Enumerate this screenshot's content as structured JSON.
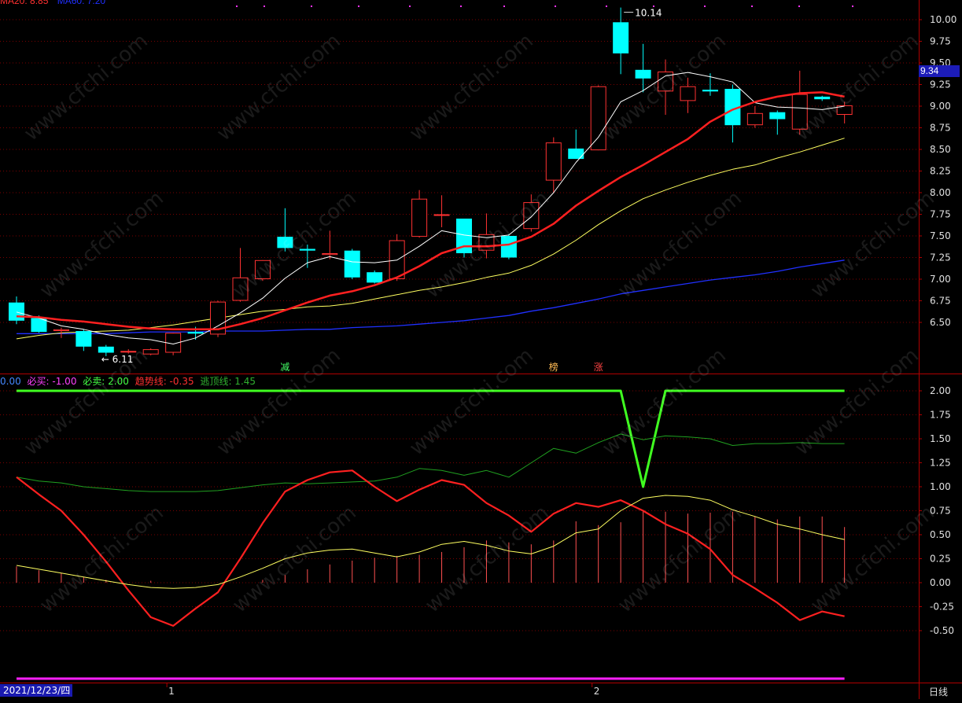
{
  "colors": {
    "up": "#ff3232",
    "down": "#00ffff",
    "ma_white": "#ffffff",
    "ma_red": "#ff2020",
    "ma_yellow": "#ffff60",
    "ma_blue": "#2030ff",
    "grid": "#7a0000",
    "axis_text": "#e0e0e0"
  },
  "top_legend": {
    "ma_text": "MA20: 8.85",
    "extra_text": "MA60: 7.20"
  },
  "price_tag": "9.34",
  "date_label": "2021/12/23/四",
  "period_label": "日线",
  "chart_data": [
    {
      "type": "candlestick",
      "ylim": [
        6.0,
        10.25
      ],
      "y_ticks": [
        "10.00",
        "9.75",
        "9.50",
        "9.25",
        "9.00",
        "8.75",
        "8.50",
        "8.25",
        "8.00",
        "7.75",
        "7.50",
        "7.25",
        "7.00",
        "6.75",
        "6.50"
      ],
      "x_ticks": [
        "1",
        "2"
      ],
      "annotations": {
        "high_label": "10.14",
        "low_label": "6.11"
      },
      "signals": [
        {
          "text": "减",
          "index": 12,
          "color": "#44ff66"
        },
        {
          "text": "榜",
          "index": 24,
          "color": "#ffbb55"
        },
        {
          "text": "涨",
          "index": 26,
          "color": "#ff4444"
        }
      ],
      "candles": [
        {
          "o": 6.73,
          "h": 6.8,
          "l": 6.48,
          "c": 6.52
        },
        {
          "o": 6.55,
          "h": 6.58,
          "l": 6.38,
          "c": 6.39
        },
        {
          "o": 6.4,
          "h": 6.44,
          "l": 6.32,
          "c": 6.42
        },
        {
          "o": 6.4,
          "h": 6.42,
          "l": 6.17,
          "c": 6.22
        },
        {
          "o": 6.22,
          "h": 6.24,
          "l": 6.11,
          "c": 6.15
        },
        {
          "o": 6.16,
          "h": 6.19,
          "l": 6.14,
          "c": 6.17
        },
        {
          "o": 6.13,
          "h": 6.2,
          "l": 6.12,
          "c": 6.19
        },
        {
          "o": 6.15,
          "h": 6.38,
          "l": 6.12,
          "c": 6.38
        },
        {
          "o": 6.39,
          "h": 6.45,
          "l": 6.3,
          "c": 6.37
        },
        {
          "o": 6.36,
          "h": 6.75,
          "l": 6.33,
          "c": 6.74
        },
        {
          "o": 6.75,
          "h": 7.36,
          "l": 6.74,
          "c": 7.02
        },
        {
          "o": 7.0,
          "h": 7.22,
          "l": 6.98,
          "c": 7.22
        },
        {
          "o": 7.49,
          "h": 7.82,
          "l": 7.32,
          "c": 7.36
        },
        {
          "o": 7.35,
          "h": 7.4,
          "l": 7.13,
          "c": 7.33
        },
        {
          "o": 7.28,
          "h": 7.56,
          "l": 7.23,
          "c": 7.3
        },
        {
          "o": 7.33,
          "h": 7.35,
          "l": 7.0,
          "c": 7.02
        },
        {
          "o": 7.08,
          "h": 7.1,
          "l": 6.95,
          "c": 6.96
        },
        {
          "o": 7.0,
          "h": 7.52,
          "l": 6.98,
          "c": 7.45
        },
        {
          "o": 7.49,
          "h": 8.03,
          "l": 7.48,
          "c": 7.93
        },
        {
          "o": 7.75,
          "h": 7.97,
          "l": 7.6,
          "c": 7.75
        },
        {
          "o": 7.7,
          "h": 7.7,
          "l": 7.25,
          "c": 7.3
        },
        {
          "o": 7.33,
          "h": 7.76,
          "l": 7.24,
          "c": 7.52
        },
        {
          "o": 7.5,
          "h": 7.52,
          "l": 7.23,
          "c": 7.25
        },
        {
          "o": 7.58,
          "h": 7.98,
          "l": 7.55,
          "c": 7.89
        },
        {
          "o": 8.14,
          "h": 8.64,
          "l": 8.0,
          "c": 8.58
        },
        {
          "o": 8.51,
          "h": 8.73,
          "l": 8.39,
          "c": 8.39
        },
        {
          "o": 8.49,
          "h": 9.24,
          "l": 8.49,
          "c": 9.23
        },
        {
          "o": 9.97,
          "h": 10.14,
          "l": 9.37,
          "c": 9.61
        },
        {
          "o": 9.42,
          "h": 9.72,
          "l": 9.16,
          "c": 9.32
        },
        {
          "o": 9.17,
          "h": 9.54,
          "l": 8.9,
          "c": 9.4
        },
        {
          "o": 9.06,
          "h": 9.33,
          "l": 8.92,
          "c": 9.23
        },
        {
          "o": 9.19,
          "h": 9.38,
          "l": 9.12,
          "c": 9.17
        },
        {
          "o": 9.2,
          "h": 9.25,
          "l": 8.58,
          "c": 8.78
        },
        {
          "o": 8.78,
          "h": 9.0,
          "l": 8.75,
          "c": 8.92
        },
        {
          "o": 8.93,
          "h": 8.95,
          "l": 8.67,
          "c": 8.85
        },
        {
          "o": 8.73,
          "h": 9.41,
          "l": 8.67,
          "c": 9.14
        },
        {
          "o": 9.11,
          "h": 9.12,
          "l": 9.06,
          "c": 9.08
        },
        {
          "o": 8.9,
          "h": 9.05,
          "l": 8.8,
          "c": 9.01
        }
      ],
      "ma_white": [
        6.62,
        6.55,
        6.46,
        6.42,
        6.36,
        6.32,
        6.3,
        6.25,
        6.32,
        6.46,
        6.61,
        6.78,
        7.01,
        7.19,
        7.26,
        7.2,
        7.19,
        7.22,
        7.38,
        7.56,
        7.51,
        7.48,
        7.51,
        7.72,
        8.0,
        8.35,
        8.64,
        9.05,
        9.18,
        9.35,
        9.39,
        9.34,
        9.28,
        9.04,
        8.99,
        8.98,
        8.96,
        9.0
      ],
      "ma_red": [
        6.57,
        6.56,
        6.53,
        6.51,
        6.48,
        6.45,
        6.43,
        6.42,
        6.42,
        6.42,
        6.48,
        6.55,
        6.64,
        6.73,
        6.81,
        6.86,
        6.93,
        7.02,
        7.15,
        7.3,
        7.38,
        7.38,
        7.4,
        7.49,
        7.64,
        7.85,
        8.02,
        8.18,
        8.32,
        8.47,
        8.62,
        8.82,
        8.96,
        9.05,
        9.11,
        9.15,
        9.16,
        9.11
      ],
      "ma_yellow": [
        6.31,
        6.35,
        6.38,
        6.39,
        6.4,
        6.41,
        6.44,
        6.47,
        6.51,
        6.55,
        6.59,
        6.63,
        6.65,
        6.68,
        6.69,
        6.72,
        6.77,
        6.82,
        6.87,
        6.91,
        6.96,
        7.02,
        7.07,
        7.16,
        7.29,
        7.45,
        7.63,
        7.79,
        7.93,
        8.03,
        8.12,
        8.2,
        8.27,
        8.32,
        8.4,
        8.47,
        8.55,
        8.63
      ],
      "ma_blue": [
        6.37,
        6.37,
        6.37,
        6.37,
        6.37,
        6.38,
        6.39,
        6.39,
        6.39,
        6.4,
        6.4,
        6.4,
        6.41,
        6.42,
        6.42,
        6.44,
        6.45,
        6.46,
        6.48,
        6.5,
        6.52,
        6.55,
        6.58,
        6.63,
        6.67,
        6.72,
        6.77,
        6.83,
        6.87,
        6.91,
        6.95,
        6.99,
        7.02,
        7.05,
        7.09,
        7.14,
        7.18,
        7.22
      ]
    },
    {
      "type": "line",
      "ylim": [
        -0.8,
        2.25
      ],
      "y_ticks": [
        "2.00",
        "1.75",
        "1.50",
        "1.25",
        "1.00",
        "0.75",
        "0.50",
        "0.25",
        "0.00",
        "-0.25",
        "-0.50"
      ],
      "legend": [
        {
          "text": "0.00",
          "color": "#4488ff"
        },
        {
          "text": "必买: -1.00",
          "color": "#ff40ff"
        },
        {
          "text": "必卖: 2.00",
          "color": "#44ff44"
        },
        {
          "text": "趋势线: -0.35",
          "color": "#ff3030"
        },
        {
          "text": "逃顶线: 1.45",
          "color": "#30b030"
        }
      ],
      "series": [
        {
          "name": "必卖",
          "color": "#40ff20",
          "width": 3,
          "values": [
            2,
            2,
            2,
            2,
            2,
            2,
            2,
            2,
            2,
            2,
            2,
            2,
            2,
            2,
            2,
            2,
            2,
            2,
            2,
            2,
            2,
            2,
            2,
            2,
            2,
            2,
            2,
            2,
            1.0,
            2,
            2,
            2,
            2,
            2,
            2,
            2,
            2,
            2
          ]
        },
        {
          "name": "逃顶线",
          "color": "#20a020",
          "width": 1,
          "values": [
            1.1,
            1.06,
            1.04,
            1.0,
            0.98,
            0.96,
            0.95,
            0.95,
            0.95,
            0.96,
            0.99,
            1.02,
            1.04,
            1.03,
            1.04,
            1.05,
            1.06,
            1.1,
            1.19,
            1.17,
            1.12,
            1.17,
            1.1,
            1.25,
            1.4,
            1.35,
            1.46,
            1.55,
            1.49,
            1.53,
            1.52,
            1.5,
            1.43,
            1.45,
            1.45,
            1.46,
            1.45,
            1.45
          ]
        },
        {
          "name": "趋势线",
          "color": "#ff2020",
          "width": 2.2,
          "values": [
            1.1,
            0.92,
            0.75,
            0.5,
            0.22,
            -0.08,
            -0.36,
            -0.45,
            -0.27,
            -0.1,
            0.25,
            0.62,
            0.95,
            1.07,
            1.15,
            1.17,
            1.0,
            0.85,
            0.97,
            1.07,
            1.02,
            0.83,
            0.7,
            0.53,
            0.72,
            0.83,
            0.79,
            0.86,
            0.75,
            0.61,
            0.51,
            0.35,
            0.08,
            -0.06,
            -0.21,
            -0.39,
            -0.3,
            -0.35
          ]
        },
        {
          "name": "黄线",
          "color": "#ffff60",
          "width": 1,
          "values": [
            0.18,
            0.14,
            0.1,
            0.06,
            0.02,
            -0.02,
            -0.05,
            -0.06,
            -0.05,
            -0.02,
            0.06,
            0.15,
            0.25,
            0.31,
            0.34,
            0.35,
            0.31,
            0.27,
            0.32,
            0.4,
            0.43,
            0.39,
            0.33,
            0.3,
            0.38,
            0.52,
            0.56,
            0.75,
            0.88,
            0.91,
            0.9,
            0.86,
            0.76,
            0.69,
            0.61,
            0.56,
            0.5,
            0.45
          ]
        },
        {
          "name": "紫线",
          "color": "#ff20ff",
          "width": 3,
          "values": [
            -1.0,
            -1.0,
            -1.0,
            -1.0,
            -1.0,
            -1.0,
            -1.0,
            -1.0,
            -1.0,
            -1.0,
            -1.0,
            -1.0,
            -1.0,
            -1.0,
            -1.0,
            -1.0,
            -1.0,
            -1.0,
            -1.0,
            -1.0,
            -1.0,
            -1.0,
            -1.0,
            -1.0,
            -1.0,
            -1.0,
            -1.0,
            -1.0,
            -1.0,
            -1.0,
            -1.0,
            -1.0,
            -1.0,
            -1.0,
            -1.0,
            -1.0,
            -1.0,
            -1.0
          ]
        }
      ],
      "bars": [
        0.17,
        0.13,
        0.1,
        0.06,
        0.03,
        0,
        0.02,
        0,
        0,
        0,
        0,
        0.03,
        0.08,
        0.14,
        0.19,
        0.23,
        0.26,
        0.28,
        0.29,
        0.32,
        0.37,
        0.44,
        0.42,
        0.4,
        0.44,
        0.64,
        0.6,
        0.63,
        0.75,
        0.74,
        0.72,
        0.73,
        0.74,
        0.69,
        0.66,
        0.69,
        0.69,
        0.58
      ]
    }
  ]
}
